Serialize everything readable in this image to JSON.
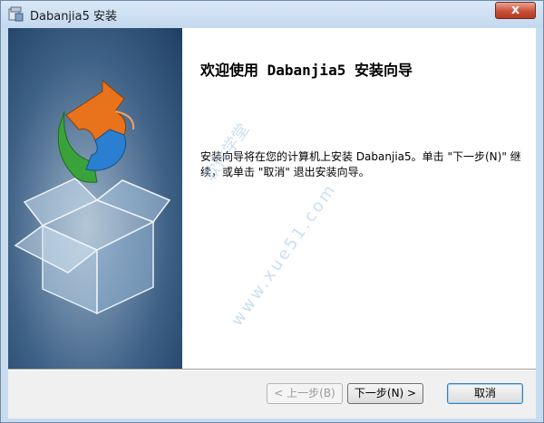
{
  "window": {
    "title": "Dabanjia5 安装",
    "close_label": "x"
  },
  "wizard": {
    "heading": "欢迎使用 Dabanjia5 安装向导",
    "description": "安装向导将在您的计算机上安装 Dabanjia5。单击 \"下一步(N)\" 继续，或单击 \"取消\" 退出安装向导。",
    "watermark_cn": "软件学堂",
    "watermark_url": "www.xue51.com"
  },
  "buttons": {
    "back": "< 上一步(B)",
    "next": "下一步(N) >",
    "cancel": "取消"
  },
  "colors": {
    "accent_orange": "#e8731c",
    "accent_green": "#3aa23a",
    "accent_blue": "#2a7fd0",
    "banner_dark": "#1f3f63"
  }
}
